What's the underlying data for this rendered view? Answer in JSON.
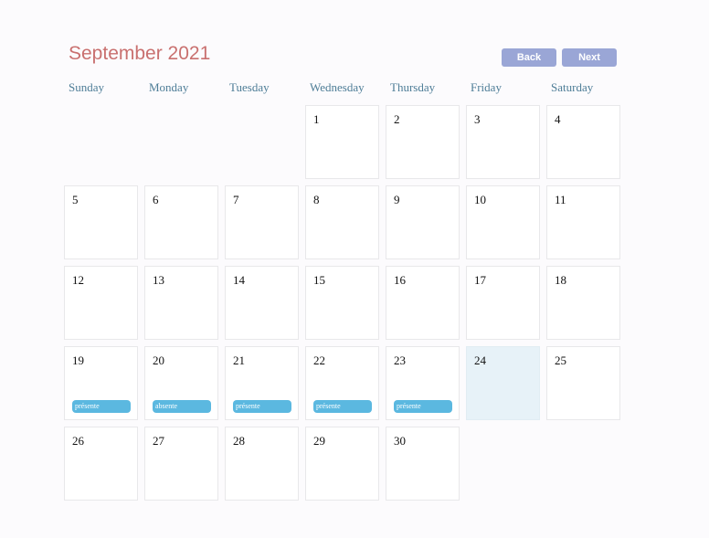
{
  "calendar": {
    "title": "September 2021",
    "toolbar": {
      "back_label": "Back",
      "next_label": "Next"
    },
    "weekdays": [
      "Sunday",
      "Monday",
      "Tuesday",
      "Wednesday",
      "Thursday",
      "Friday",
      "Saturday"
    ],
    "today": 24,
    "weeks": [
      [
        null,
        null,
        null,
        1,
        2,
        3,
        4
      ],
      [
        5,
        6,
        7,
        8,
        9,
        10,
        11
      ],
      [
        12,
        13,
        14,
        15,
        16,
        17,
        18
      ],
      [
        19,
        20,
        21,
        22,
        23,
        24,
        25
      ],
      [
        26,
        27,
        28,
        29,
        30,
        null,
        null
      ]
    ],
    "events": [
      {
        "day": 19,
        "label": "présente"
      },
      {
        "day": 20,
        "label": "absente"
      },
      {
        "day": 21,
        "label": "présente"
      },
      {
        "day": 22,
        "label": "présente"
      },
      {
        "day": 23,
        "label": "présente"
      }
    ]
  },
  "colors": {
    "title": "#c9706f",
    "button": "#9aa6d6",
    "weekday": "#4e7d97",
    "event": "#5bb8e0",
    "today": "#e7f2f8"
  }
}
